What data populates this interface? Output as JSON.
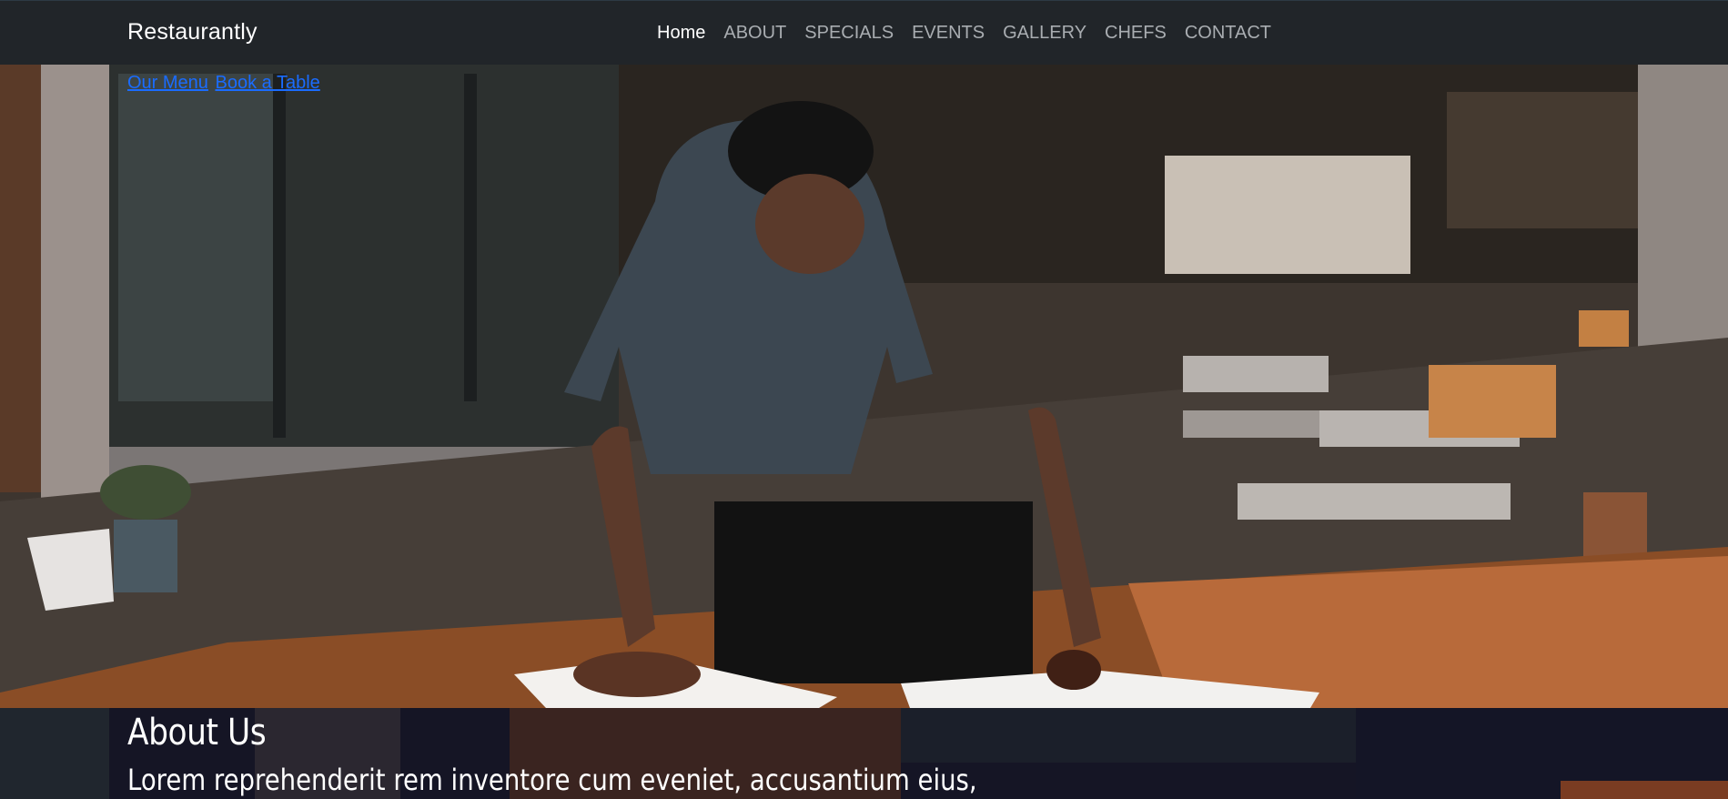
{
  "navbar": {
    "brand": "Restaurantly",
    "links": [
      {
        "label": "Home",
        "active": true
      },
      {
        "label": "ABOUT"
      },
      {
        "label": "SPECIALS"
      },
      {
        "label": "EVENTS"
      },
      {
        "label": "GALLERY"
      },
      {
        "label": "CHEFS"
      },
      {
        "label": "CONTACT"
      }
    ]
  },
  "hero": {
    "links": [
      "Our Menu",
      "Book a Table"
    ]
  },
  "about": {
    "title": "About Us",
    "text": "Lorem reprehenderit rem inventore cum eveniet, accusantium eius,"
  }
}
